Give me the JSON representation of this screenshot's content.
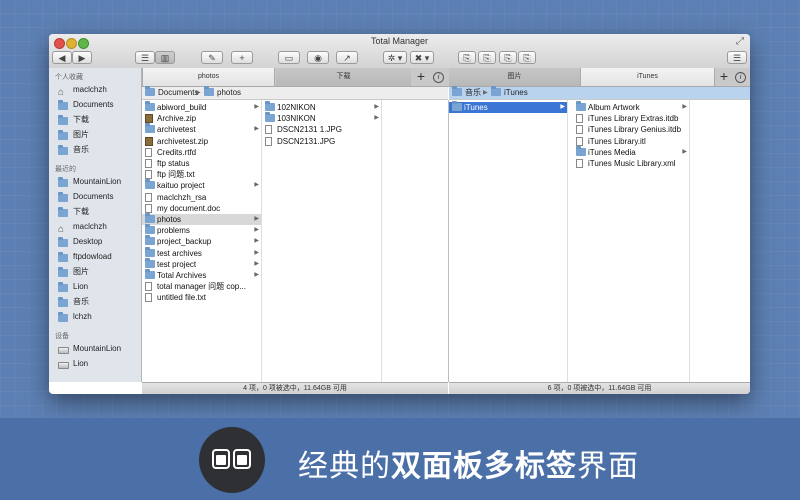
{
  "window": {
    "title": "Total Manager"
  },
  "toolbar": {
    "back": "◀",
    "forward": "▶",
    "view_list": "☰",
    "view_columns": "▥",
    "edit": "✎",
    "new": "+",
    "disk": "▭",
    "preview": "◉",
    "share": "↗",
    "action": "✲ ▾",
    "tools": "✖ ▾",
    "copy1": "⎘",
    "copy2": "⎘",
    "copy3": "⎘",
    "copy4": "⎘",
    "menu": "☰"
  },
  "tabs_left": [
    {
      "label": "photos"
    },
    {
      "label": "下载"
    }
  ],
  "tabs_right": [
    {
      "label": "图片"
    },
    {
      "label": "iTunes"
    }
  ],
  "sidebar": {
    "favorites_header": "个人收藏",
    "favorites": [
      {
        "label": "maclchzh",
        "icon": "home"
      },
      {
        "label": "Documents",
        "icon": "folder"
      },
      {
        "label": "下载",
        "icon": "folder"
      },
      {
        "label": "图片",
        "icon": "folder"
      },
      {
        "label": "音乐",
        "icon": "folder"
      }
    ],
    "recent_header": "最近的",
    "recent": [
      {
        "label": "MountainLion",
        "icon": "folder"
      },
      {
        "label": "Documents",
        "icon": "folder"
      },
      {
        "label": "下载",
        "icon": "folder"
      },
      {
        "label": "maclchzh",
        "icon": "home"
      },
      {
        "label": "Desktop",
        "icon": "folder"
      },
      {
        "label": "ftpdowload",
        "icon": "folder"
      },
      {
        "label": "图片",
        "icon": "folder"
      },
      {
        "label": "Lion",
        "icon": "folder"
      },
      {
        "label": "音乐",
        "icon": "folder"
      },
      {
        "label": "lchzh",
        "icon": "folder"
      }
    ],
    "devices_header": "设备",
    "devices": [
      {
        "label": "MountainLion",
        "icon": "drive"
      },
      {
        "label": "Lion",
        "icon": "drive"
      }
    ]
  },
  "left_pane": {
    "path": [
      "Documents",
      "photos"
    ],
    "col1": [
      {
        "name": "abiword_build",
        "icon": "folder",
        "arrow": true
      },
      {
        "name": "Archive.zip",
        "icon": "zip",
        "arrow": false
      },
      {
        "name": "archivetest",
        "icon": "folder",
        "arrow": true
      },
      {
        "name": "archivetest.zip",
        "icon": "zip",
        "arrow": false
      },
      {
        "name": "Credits.rtfd",
        "icon": "file",
        "arrow": false
      },
      {
        "name": "ftp status",
        "icon": "file",
        "arrow": false
      },
      {
        "name": "ftp 问题.txt",
        "icon": "file",
        "arrow": false
      },
      {
        "name": "kaituo project",
        "icon": "folder",
        "arrow": true
      },
      {
        "name": "maclchzh_rsa",
        "icon": "file",
        "arrow": false
      },
      {
        "name": "my document.doc",
        "icon": "file",
        "arrow": false
      },
      {
        "name": "photos",
        "icon": "folder",
        "arrow": true,
        "selected": true
      },
      {
        "name": "problems",
        "icon": "folder",
        "arrow": true
      },
      {
        "name": "project_backup",
        "icon": "folder",
        "arrow": true
      },
      {
        "name": "test archives",
        "icon": "folder",
        "arrow": true
      },
      {
        "name": "test project",
        "icon": "folder",
        "arrow": true
      },
      {
        "name": "Total Archives",
        "icon": "folder",
        "arrow": true
      },
      {
        "name": "total manager 问题 cop...",
        "icon": "file",
        "arrow": false
      },
      {
        "name": "untitled file.txt",
        "icon": "file",
        "arrow": false
      }
    ],
    "col2": [
      {
        "name": "102NIKON",
        "icon": "folder",
        "arrow": true
      },
      {
        "name": "103NIKON",
        "icon": "folder",
        "arrow": true
      },
      {
        "name": "DSCN2131 1.JPG",
        "icon": "file",
        "arrow": false
      },
      {
        "name": "DSCN2131.JPG",
        "icon": "file",
        "arrow": false
      }
    ],
    "status": "4 项，0 项被选中，11.64GB 可用"
  },
  "right_pane": {
    "path": [
      "音乐",
      "iTunes"
    ],
    "col1": [
      {
        "name": "iTunes",
        "icon": "folder",
        "arrow": true,
        "selected": true
      }
    ],
    "col2": [
      {
        "name": "Album Artwork",
        "icon": "folder",
        "arrow": true
      },
      {
        "name": "iTunes Library Extras.itdb",
        "icon": "file",
        "arrow": false
      },
      {
        "name": "iTunes Library Genius.itdb",
        "icon": "file",
        "arrow": false
      },
      {
        "name": "iTunes Library.itl",
        "icon": "file",
        "arrow": false
      },
      {
        "name": "iTunes Media",
        "icon": "folder",
        "arrow": true
      },
      {
        "name": "iTunes Music Library.xml",
        "icon": "file",
        "arrow": false
      }
    ],
    "status": "6 项，0 项被选中，11.64GB 可用"
  },
  "caption": {
    "part1": "经典的",
    "part2": "双面板多标签",
    "part3": "界面"
  },
  "colors": {
    "background": "#5d80b4",
    "band": "#4b70a8",
    "selection": "#3b76d4"
  }
}
